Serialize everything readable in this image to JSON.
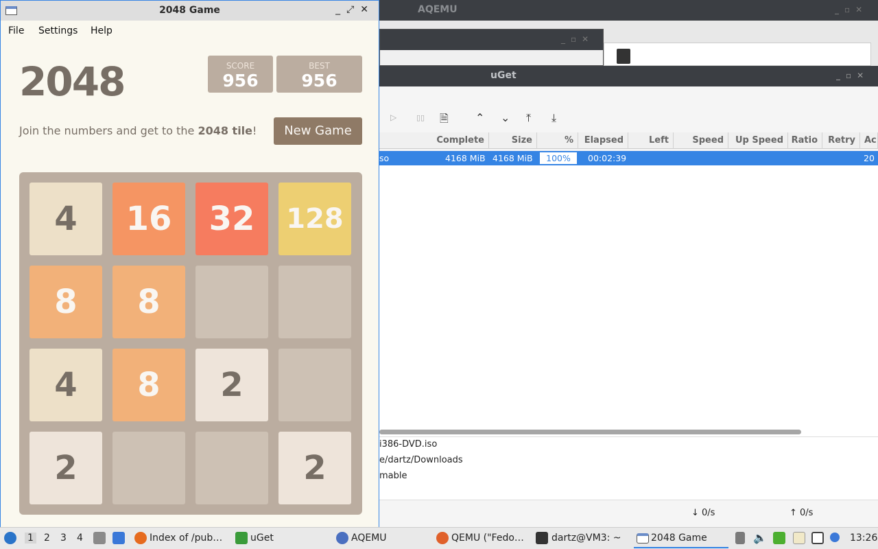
{
  "aqemu": {
    "title": "AQEMU"
  },
  "uget": {
    "title": "uGet",
    "columns": [
      "Complete",
      "Size",
      "%",
      "Elapsed",
      "Left",
      "Speed",
      "Up Speed",
      "Ratio",
      "Retry",
      "Ac"
    ],
    "row": {
      "name": "so",
      "complete": "4168 MiB",
      "size": "4168 MiB",
      "percent": "100%",
      "elapsed": "00:02:39",
      "added": "20"
    },
    "info": {
      "file": "i386-DVD.iso",
      "folder": "e/dartz/Downloads",
      "status": "mable"
    },
    "status": {
      "down": "↓ 0/s",
      "up": "↑ 0/s"
    }
  },
  "game_window": {
    "title": "2048 Game",
    "menu": [
      "File",
      "Settings",
      "Help"
    ],
    "logo": "2048",
    "score_label": "SCORE",
    "score": "956",
    "best_label": "BEST",
    "best": "956",
    "intro_prefix": "Join the numbers and get to the ",
    "intro_bold": "2048 tile",
    "intro_suffix": "!",
    "new_game": "New Game",
    "grid": [
      [
        "4",
        "16",
        "32",
        "128"
      ],
      [
        "8",
        "8",
        "",
        ""
      ],
      [
        "4",
        "8",
        "2",
        ""
      ],
      [
        "2",
        "",
        "",
        "2"
      ]
    ],
    "tile_colors": {
      "2": {
        "bg": "#eee4da",
        "fg": "#776e65"
      },
      "4": {
        "bg": "#ede0c8",
        "fg": "#776e65"
      },
      "8": {
        "bg": "#f2b179",
        "fg": "#f9f6f2"
      },
      "16": {
        "bg": "#f59563",
        "fg": "#f9f6f2"
      },
      "32": {
        "bg": "#f67c5f",
        "fg": "#f9f6f2"
      },
      "128": {
        "bg": "#edcf72",
        "fg": "#f9f6f2"
      }
    }
  },
  "taskbar": {
    "workspaces": [
      "1",
      "2",
      "3",
      "4"
    ],
    "tasks": [
      "Index of /pub…",
      "uGet",
      "AQEMU",
      "QEMU (\"Fedo…",
      "dartz@VM3: ~",
      "2048 Game"
    ],
    "clock": "13:26"
  }
}
